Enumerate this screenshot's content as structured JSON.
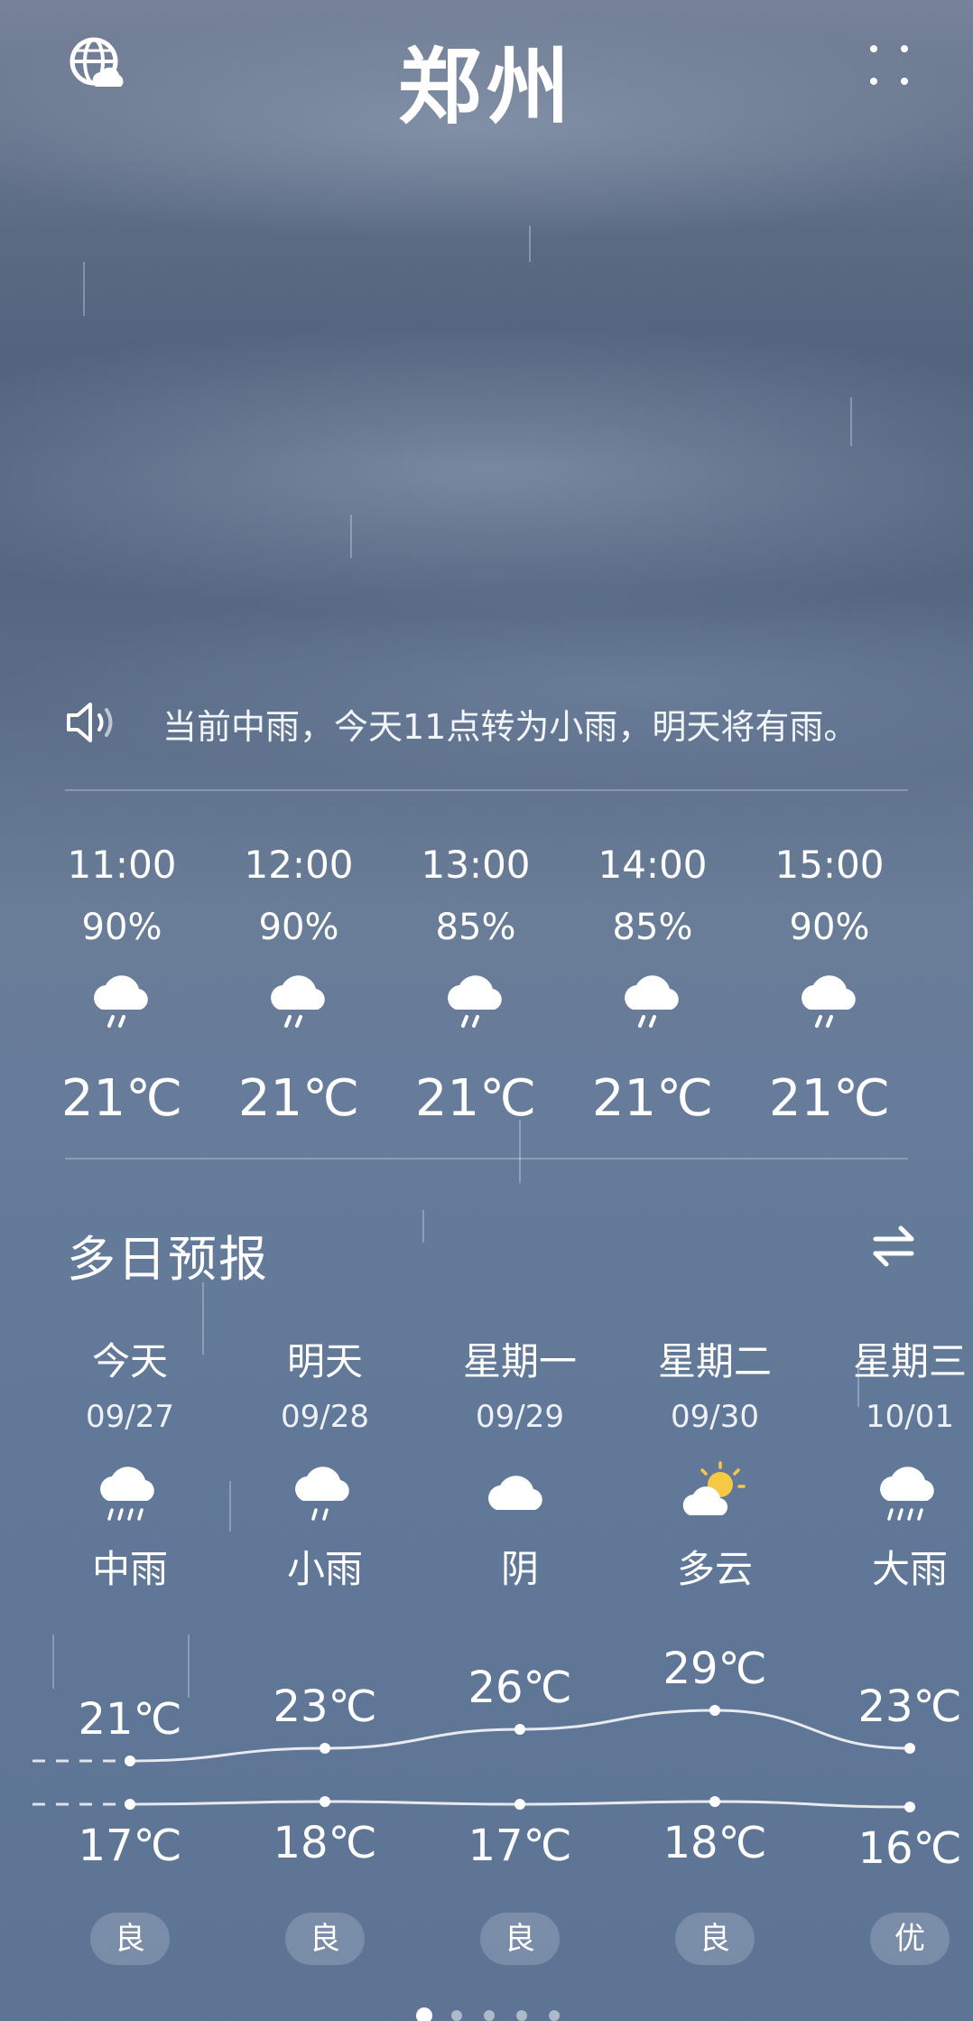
{
  "city": "郑州",
  "alert": {
    "text": "当前中雨，今天11点转为小雨，明天将有雨。"
  },
  "hourly": [
    {
      "time": "11:00",
      "prob": "90%",
      "icon": "rain-cloud-icon",
      "temp": "21℃"
    },
    {
      "time": "12:00",
      "prob": "90%",
      "icon": "rain-cloud-icon",
      "temp": "21℃"
    },
    {
      "time": "13:00",
      "prob": "85%",
      "icon": "rain-cloud-icon",
      "temp": "21℃"
    },
    {
      "time": "14:00",
      "prob": "85%",
      "icon": "rain-cloud-icon",
      "temp": "21℃"
    },
    {
      "time": "15:00",
      "prob": "90%",
      "icon": "rain-cloud-icon",
      "temp": "21℃"
    }
  ],
  "multi_day": {
    "title": "多日预报",
    "days": [
      {
        "name": "今天",
        "date": "09/27",
        "icon": "moderate-rain-icon",
        "condition": "中雨",
        "high": "21℃",
        "low": "17℃",
        "high_value": 21,
        "low_value": 17,
        "aqi": "良"
      },
      {
        "name": "明天",
        "date": "09/28",
        "icon": "light-rain-icon",
        "condition": "小雨",
        "high": "23℃",
        "low": "18℃",
        "high_value": 23,
        "low_value": 18,
        "aqi": "良"
      },
      {
        "name": "星期一",
        "date": "09/29",
        "icon": "overcast-cloud-icon",
        "condition": "阴",
        "high": "26℃",
        "low": "17℃",
        "high_value": 26,
        "low_value": 17,
        "aqi": "良"
      },
      {
        "name": "星期二",
        "date": "09/30",
        "icon": "partly-cloudy-icon",
        "condition": "多云",
        "high": "29℃",
        "low": "18℃",
        "high_value": 29,
        "low_value": 18,
        "aqi": "良"
      },
      {
        "name": "星期三",
        "date": "10/01",
        "icon": "heavy-rain-icon",
        "condition": "大雨",
        "high": "23℃",
        "low": "16℃",
        "high_value": 23,
        "low_value": 16,
        "aqi": "优"
      }
    ]
  },
  "pager": {
    "count": 5,
    "active": 0
  },
  "colors": {
    "text": "#ffffff",
    "sun": "#f7c843"
  }
}
